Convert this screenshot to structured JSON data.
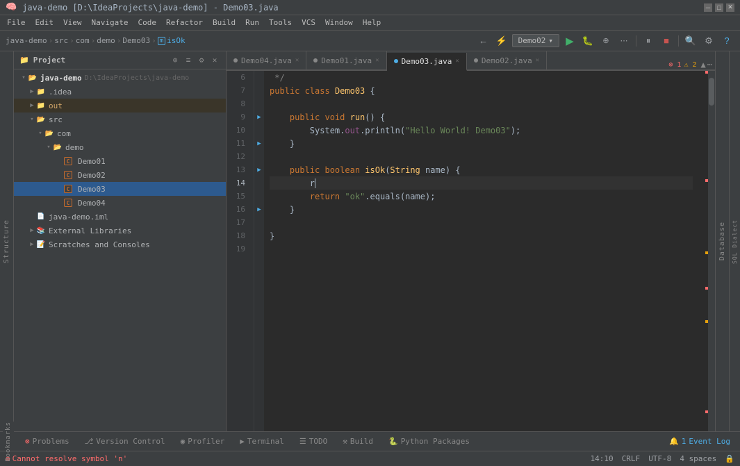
{
  "window": {
    "title": "java-demo [D:\\IdeaProjects\\java-demo] - Demo03.java",
    "minimize": "─",
    "maximize": "□",
    "close": "✕"
  },
  "menu": {
    "items": [
      "File",
      "Edit",
      "View",
      "Navigate",
      "Code",
      "Refactor",
      "Build",
      "Run",
      "Tools",
      "VCS",
      "Window",
      "Help"
    ]
  },
  "breadcrumb": {
    "items": [
      "java-demo",
      "src",
      "com",
      "demo",
      "Demo03",
      "isOk"
    ]
  },
  "toolbar": {
    "run_config": "Demo02",
    "search_label": "🔍",
    "settings_label": "⚙"
  },
  "project_panel": {
    "title": "Project",
    "root": {
      "name": "java-demo",
      "path": "D:\\IdeaProjects\\java-demo",
      "children": [
        {
          "name": ".idea",
          "type": "folder",
          "expanded": false
        },
        {
          "name": "out",
          "type": "folder",
          "expanded": false,
          "color": "orange"
        },
        {
          "name": "src",
          "type": "folder",
          "expanded": true,
          "children": [
            {
              "name": "com",
              "type": "folder",
              "expanded": true,
              "children": [
                {
                  "name": "demo",
                  "type": "folder",
                  "expanded": true,
                  "children": [
                    {
                      "name": "Demo01",
                      "type": "java",
                      "selected": false
                    },
                    {
                      "name": "Demo02",
                      "type": "java",
                      "selected": false
                    },
                    {
                      "name": "Demo03",
                      "type": "java",
                      "selected": true
                    },
                    {
                      "name": "Demo04",
                      "type": "java",
                      "selected": false
                    }
                  ]
                }
              ]
            }
          ]
        },
        {
          "name": "java-demo.iml",
          "type": "iml"
        },
        {
          "name": "External Libraries",
          "type": "extlib"
        },
        {
          "name": "Scratches and Consoles",
          "type": "scratches"
        }
      ]
    }
  },
  "tabs": [
    {
      "name": "Demo04.java",
      "active": false,
      "dot_color": "#888"
    },
    {
      "name": "Demo01.java",
      "active": false,
      "dot_color": "#888"
    },
    {
      "name": "Demo03.java",
      "active": true,
      "dot_color": "#4eade5"
    },
    {
      "name": "Demo02.java",
      "active": false,
      "dot_color": "#888"
    }
  ],
  "editor": {
    "error_count": "1",
    "warn_count": "2",
    "lines": [
      {
        "num": "6",
        "content": " */",
        "type": "comment"
      },
      {
        "num": "7",
        "content": "public class Demo03 {",
        "type": "code"
      },
      {
        "num": "8",
        "content": "",
        "type": "empty"
      },
      {
        "num": "9",
        "content": "    public void run() {",
        "type": "code"
      },
      {
        "num": "10",
        "content": "        System.out.println(\"Hello World! Demo03\");",
        "type": "code"
      },
      {
        "num": "11",
        "content": "    }",
        "type": "code"
      },
      {
        "num": "12",
        "content": "",
        "type": "empty"
      },
      {
        "num": "13",
        "content": "    public boolean isOk(String name) {",
        "type": "code"
      },
      {
        "num": "14",
        "content": "        r",
        "type": "code",
        "current": true,
        "has_cursor": true
      },
      {
        "num": "15",
        "content": "        return \"ok\".equals(name);",
        "type": "code"
      },
      {
        "num": "16",
        "content": "    }",
        "type": "code"
      },
      {
        "num": "17",
        "content": "",
        "type": "empty"
      },
      {
        "num": "18",
        "content": "}",
        "type": "code"
      },
      {
        "num": "19",
        "content": "",
        "type": "empty"
      }
    ]
  },
  "bottom_tabs": [
    {
      "name": "Problems",
      "icon": "⊗",
      "active": false
    },
    {
      "name": "Version Control",
      "icon": "⎇",
      "active": false
    },
    {
      "name": "Profiler",
      "icon": "◉",
      "active": false
    },
    {
      "name": "Terminal",
      "icon": "▶",
      "active": false
    },
    {
      "name": "TODO",
      "icon": "☰",
      "active": false
    },
    {
      "name": "Build",
      "icon": "⚒",
      "active": false
    },
    {
      "name": "Python Packages",
      "icon": "🐍",
      "active": false
    }
  ],
  "bottom_right_tab": {
    "name": "Event Log",
    "icon": "🔔",
    "count": "1"
  },
  "status_bar": {
    "error_text": "Cannot resolve symbol 'n'",
    "position": "14:10",
    "line_ending": "CRLF",
    "encoding": "UTF-8",
    "indent": "4 spaces"
  },
  "sidebar_labels": {
    "structure": "Structure",
    "database": "Database",
    "sqldialect": "SQL Dialect",
    "bookmarks": "Bookmarks"
  }
}
